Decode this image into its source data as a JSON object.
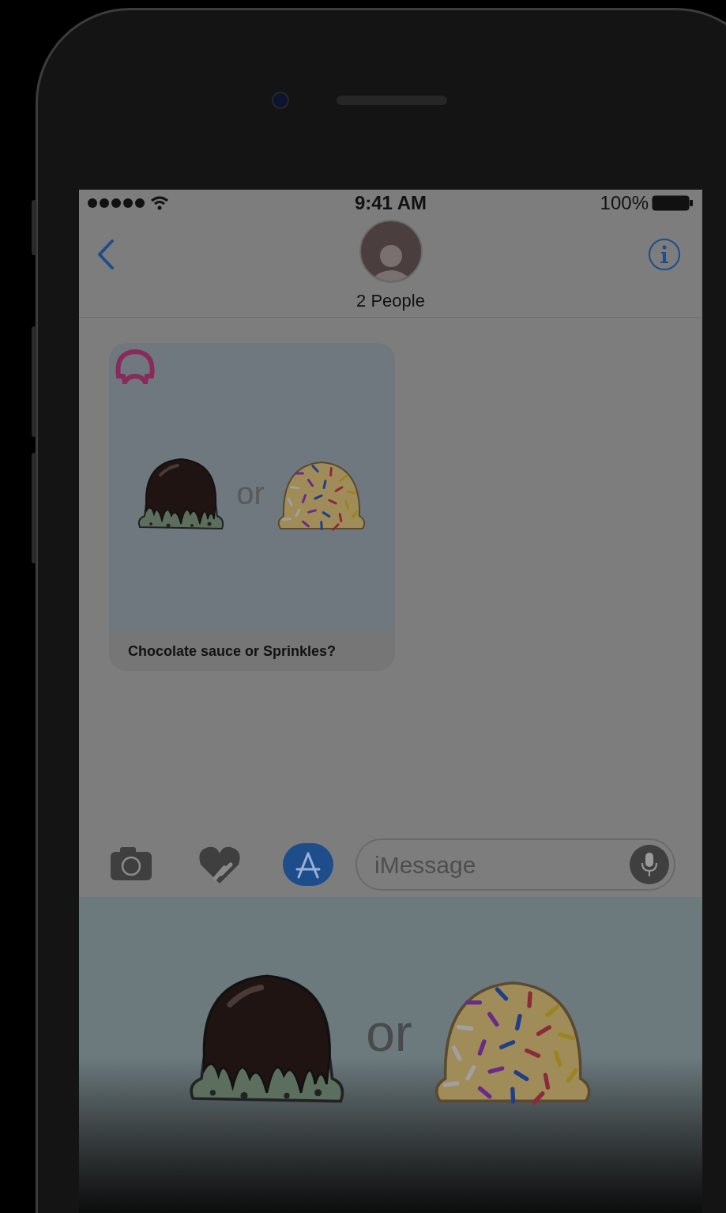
{
  "status_bar": {
    "time": "9:41 AM",
    "battery": "100%"
  },
  "nav": {
    "title": "2 People"
  },
  "message": {
    "option_separator": "or",
    "caption": "Chocolate sauce or Sprinkles?"
  },
  "toolbar": [
    {
      "kind": "camera",
      "selected": false
    },
    {
      "kind": "touch",
      "selected": false
    },
    {
      "kind": "apps",
      "selected": true
    }
  ],
  "compose": {
    "placeholder": "iMessage"
  },
  "app_panel": {
    "option_separator": "or"
  }
}
